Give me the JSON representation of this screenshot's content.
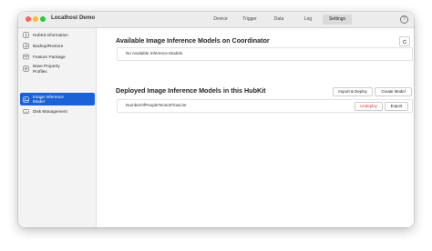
{
  "window": {
    "title": "Localhost Demo",
    "help_label": "?"
  },
  "tabs": [
    {
      "label": "Device",
      "active": false
    },
    {
      "label": "Trigger",
      "active": false
    },
    {
      "label": "Data",
      "active": false
    },
    {
      "label": "Log",
      "active": false
    },
    {
      "label": "Settings",
      "active": true
    }
  ],
  "sidebar": {
    "items": [
      {
        "label": "HubKit Information",
        "icon": "info-icon",
        "active": false
      },
      {
        "label": "Backup/Restore",
        "icon": "backup-icon",
        "active": false
      },
      {
        "label": "Feature Package",
        "icon": "package-icon",
        "active": false
      },
      {
        "label": "Base Property\nProfiles",
        "icon": "profile-icon",
        "active": false
      },
      {
        "label": "Image Inference\nModel",
        "icon": "image-model-icon",
        "active": true
      },
      {
        "label": "Disk Management",
        "icon": "disk-icon",
        "active": false
      }
    ]
  },
  "available_section": {
    "title": "Available Image Inference Models on Coordinator",
    "refresh_icon": "refresh-icon",
    "empty_text": "No Available Inference Models."
  },
  "deployed_section": {
    "title": "Deployed Image Inference Models in this HubKit",
    "import_button": "Import & Deploy",
    "create_button": "Create Model",
    "models": [
      {
        "name": "NumberOfPeopleTensorFlowLite",
        "undeploy_label": "Undeploy",
        "export_label": "Export"
      }
    ]
  },
  "colors": {
    "accent": "#1b62d7",
    "danger": "#e0302a",
    "sidebar_bg": "#f3f3f3",
    "titlebar_bg": "#ececec"
  }
}
